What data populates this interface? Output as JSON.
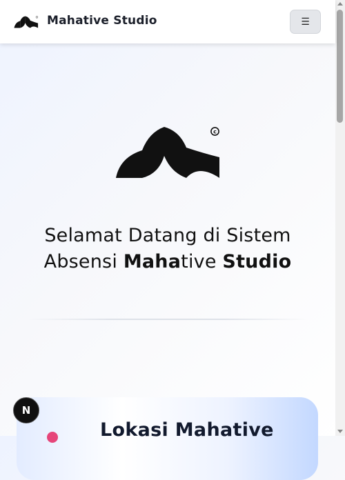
{
  "header": {
    "brand_name": "Mahative Studio",
    "logo_icon": "mahative-logo-icon",
    "menu_icon": "☰"
  },
  "hero": {
    "logo_icon": "mahative-logo-icon",
    "title_part1": "Selamat Datang di Sistem Absensi ",
    "title_bold1": "Maha",
    "title_part2": "tive ",
    "title_bold2": "Studio"
  },
  "card": {
    "title": "Lokasi Mahative"
  },
  "dev_badge": {
    "label": "N"
  },
  "colors": {
    "accent": "#e6457a",
    "card_gradient_end": "#c3d8ff",
    "text": "#111111"
  }
}
